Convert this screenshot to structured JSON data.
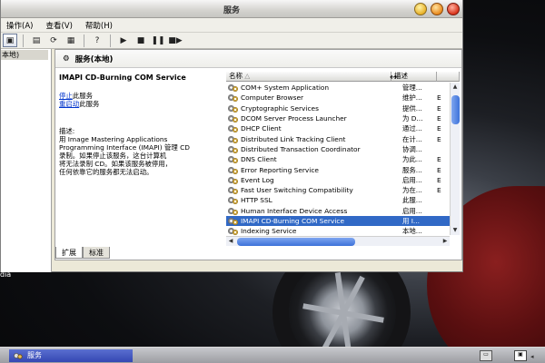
{
  "window": {
    "title": "服务",
    "menu": [
      "操作(A)",
      "查看(V)",
      "帮助(H)"
    ]
  },
  "tree": {
    "root": "本地)"
  },
  "pane": {
    "header": "服务(本地)",
    "service_name": "IMAPI CD-Burning COM Service",
    "stop_link": "停止",
    "stop_text": "此服务",
    "restart_link": "重启动",
    "restart_text": "此服务",
    "desc_title": "描述:",
    "desc_lines": [
      "用 Image Mastering Applications",
      "Programming Interface (IMAPI) 管理 CD",
      "录制。如果停止该服务，这台计算机",
      "将无法录制 CD。如果该服务被停用，",
      "任何依靠它的服务都无法启动。"
    ]
  },
  "list": {
    "col_name": "名称",
    "col_desc": "描述",
    "col_status": "",
    "rows": [
      {
        "name": "COM+ System Application",
        "desc": "管理...",
        "status": "",
        "selected": false
      },
      {
        "name": "Computer Browser",
        "desc": "维护...",
        "status": "E",
        "selected": false
      },
      {
        "name": "Cryptographic Services",
        "desc": "提供...",
        "status": "E",
        "selected": false
      },
      {
        "name": "DCOM Server Process Launcher",
        "desc": "为 D...",
        "status": "E",
        "selected": false
      },
      {
        "name": "DHCP Client",
        "desc": "通过...",
        "status": "E",
        "selected": false
      },
      {
        "name": "Distributed Link Tracking Client",
        "desc": "在计...",
        "status": "E",
        "selected": false
      },
      {
        "name": "Distributed Transaction Coordinator",
        "desc": "协调...",
        "status": "",
        "selected": false
      },
      {
        "name": "DNS Client",
        "desc": "为此...",
        "status": "E",
        "selected": false
      },
      {
        "name": "Error Reporting Service",
        "desc": "服务...",
        "status": "E",
        "selected": false
      },
      {
        "name": "Event Log",
        "desc": "启用...",
        "status": "E",
        "selected": false
      },
      {
        "name": "Fast User Switching Compatibility",
        "desc": "为在...",
        "status": "E",
        "selected": false
      },
      {
        "name": "HTTP SSL",
        "desc": "此服...",
        "status": "",
        "selected": false
      },
      {
        "name": "Human Interface Device Access",
        "desc": "启用...",
        "status": "",
        "selected": false
      },
      {
        "name": "IMAPI CD-Burning COM Service",
        "desc": "用 I...",
        "status": "",
        "selected": true
      },
      {
        "name": "Indexing Service",
        "desc": "本地...",
        "status": "",
        "selected": false
      }
    ]
  },
  "tabs": [
    "扩展",
    "标准"
  ],
  "desktop": {
    "media_label": "dia"
  },
  "taskbar": {
    "task_label": "服务"
  }
}
